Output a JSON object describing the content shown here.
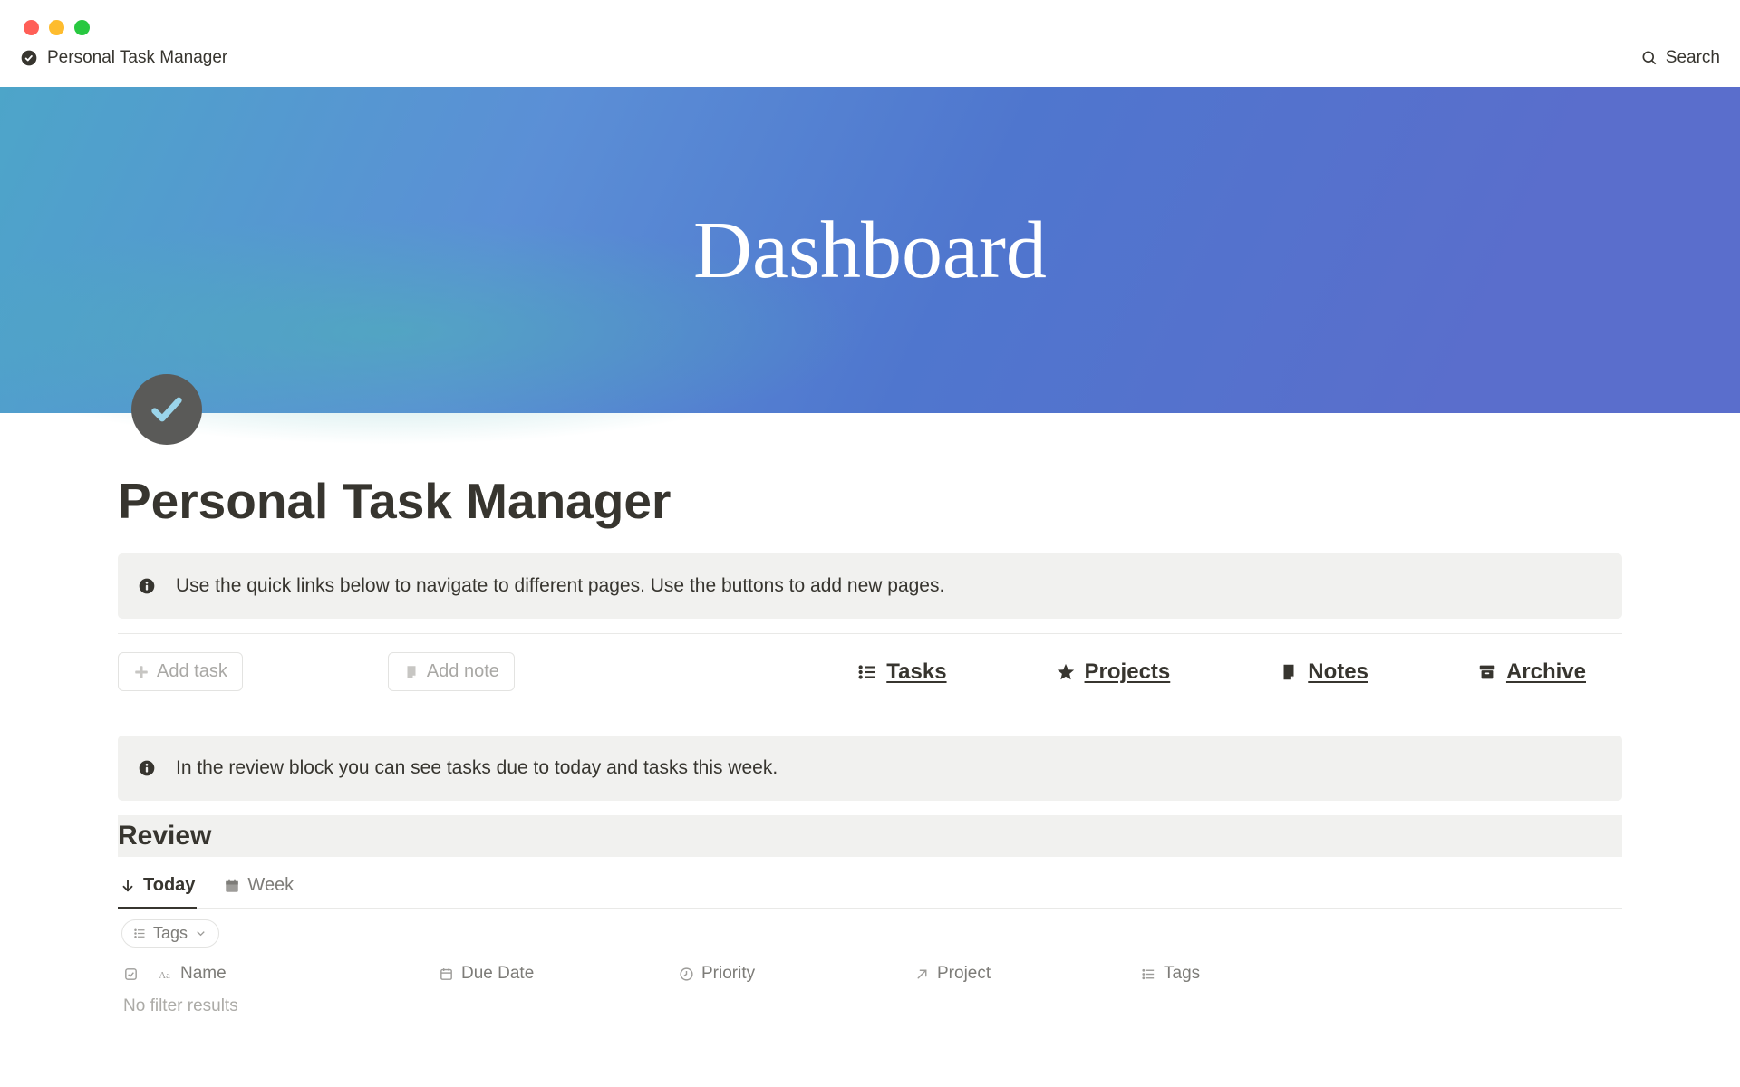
{
  "breadcrumb": {
    "title": "Personal Task Manager"
  },
  "search": {
    "label": "Search"
  },
  "cover": {
    "title": "Dashboard"
  },
  "page": {
    "title": "Personal Task Manager"
  },
  "callouts": {
    "top": "Use the quick links below to navigate to different pages. Use the buttons to add new pages.",
    "mid": "In the review block you can see tasks due to today and tasks this week."
  },
  "buttons": {
    "add_task": "Add task",
    "add_note": "Add note"
  },
  "nav": {
    "tasks": "Tasks",
    "projects": "Projects",
    "notes": "Notes",
    "archive": "Archive"
  },
  "review": {
    "title": "Review"
  },
  "tabs": {
    "today": "Today",
    "week": "Week"
  },
  "filter": {
    "tags": "Tags"
  },
  "columns": {
    "name": "Name",
    "due": "Due Date",
    "priority": "Priority",
    "project": "Project",
    "tags": "Tags"
  },
  "empty": "No filter results"
}
